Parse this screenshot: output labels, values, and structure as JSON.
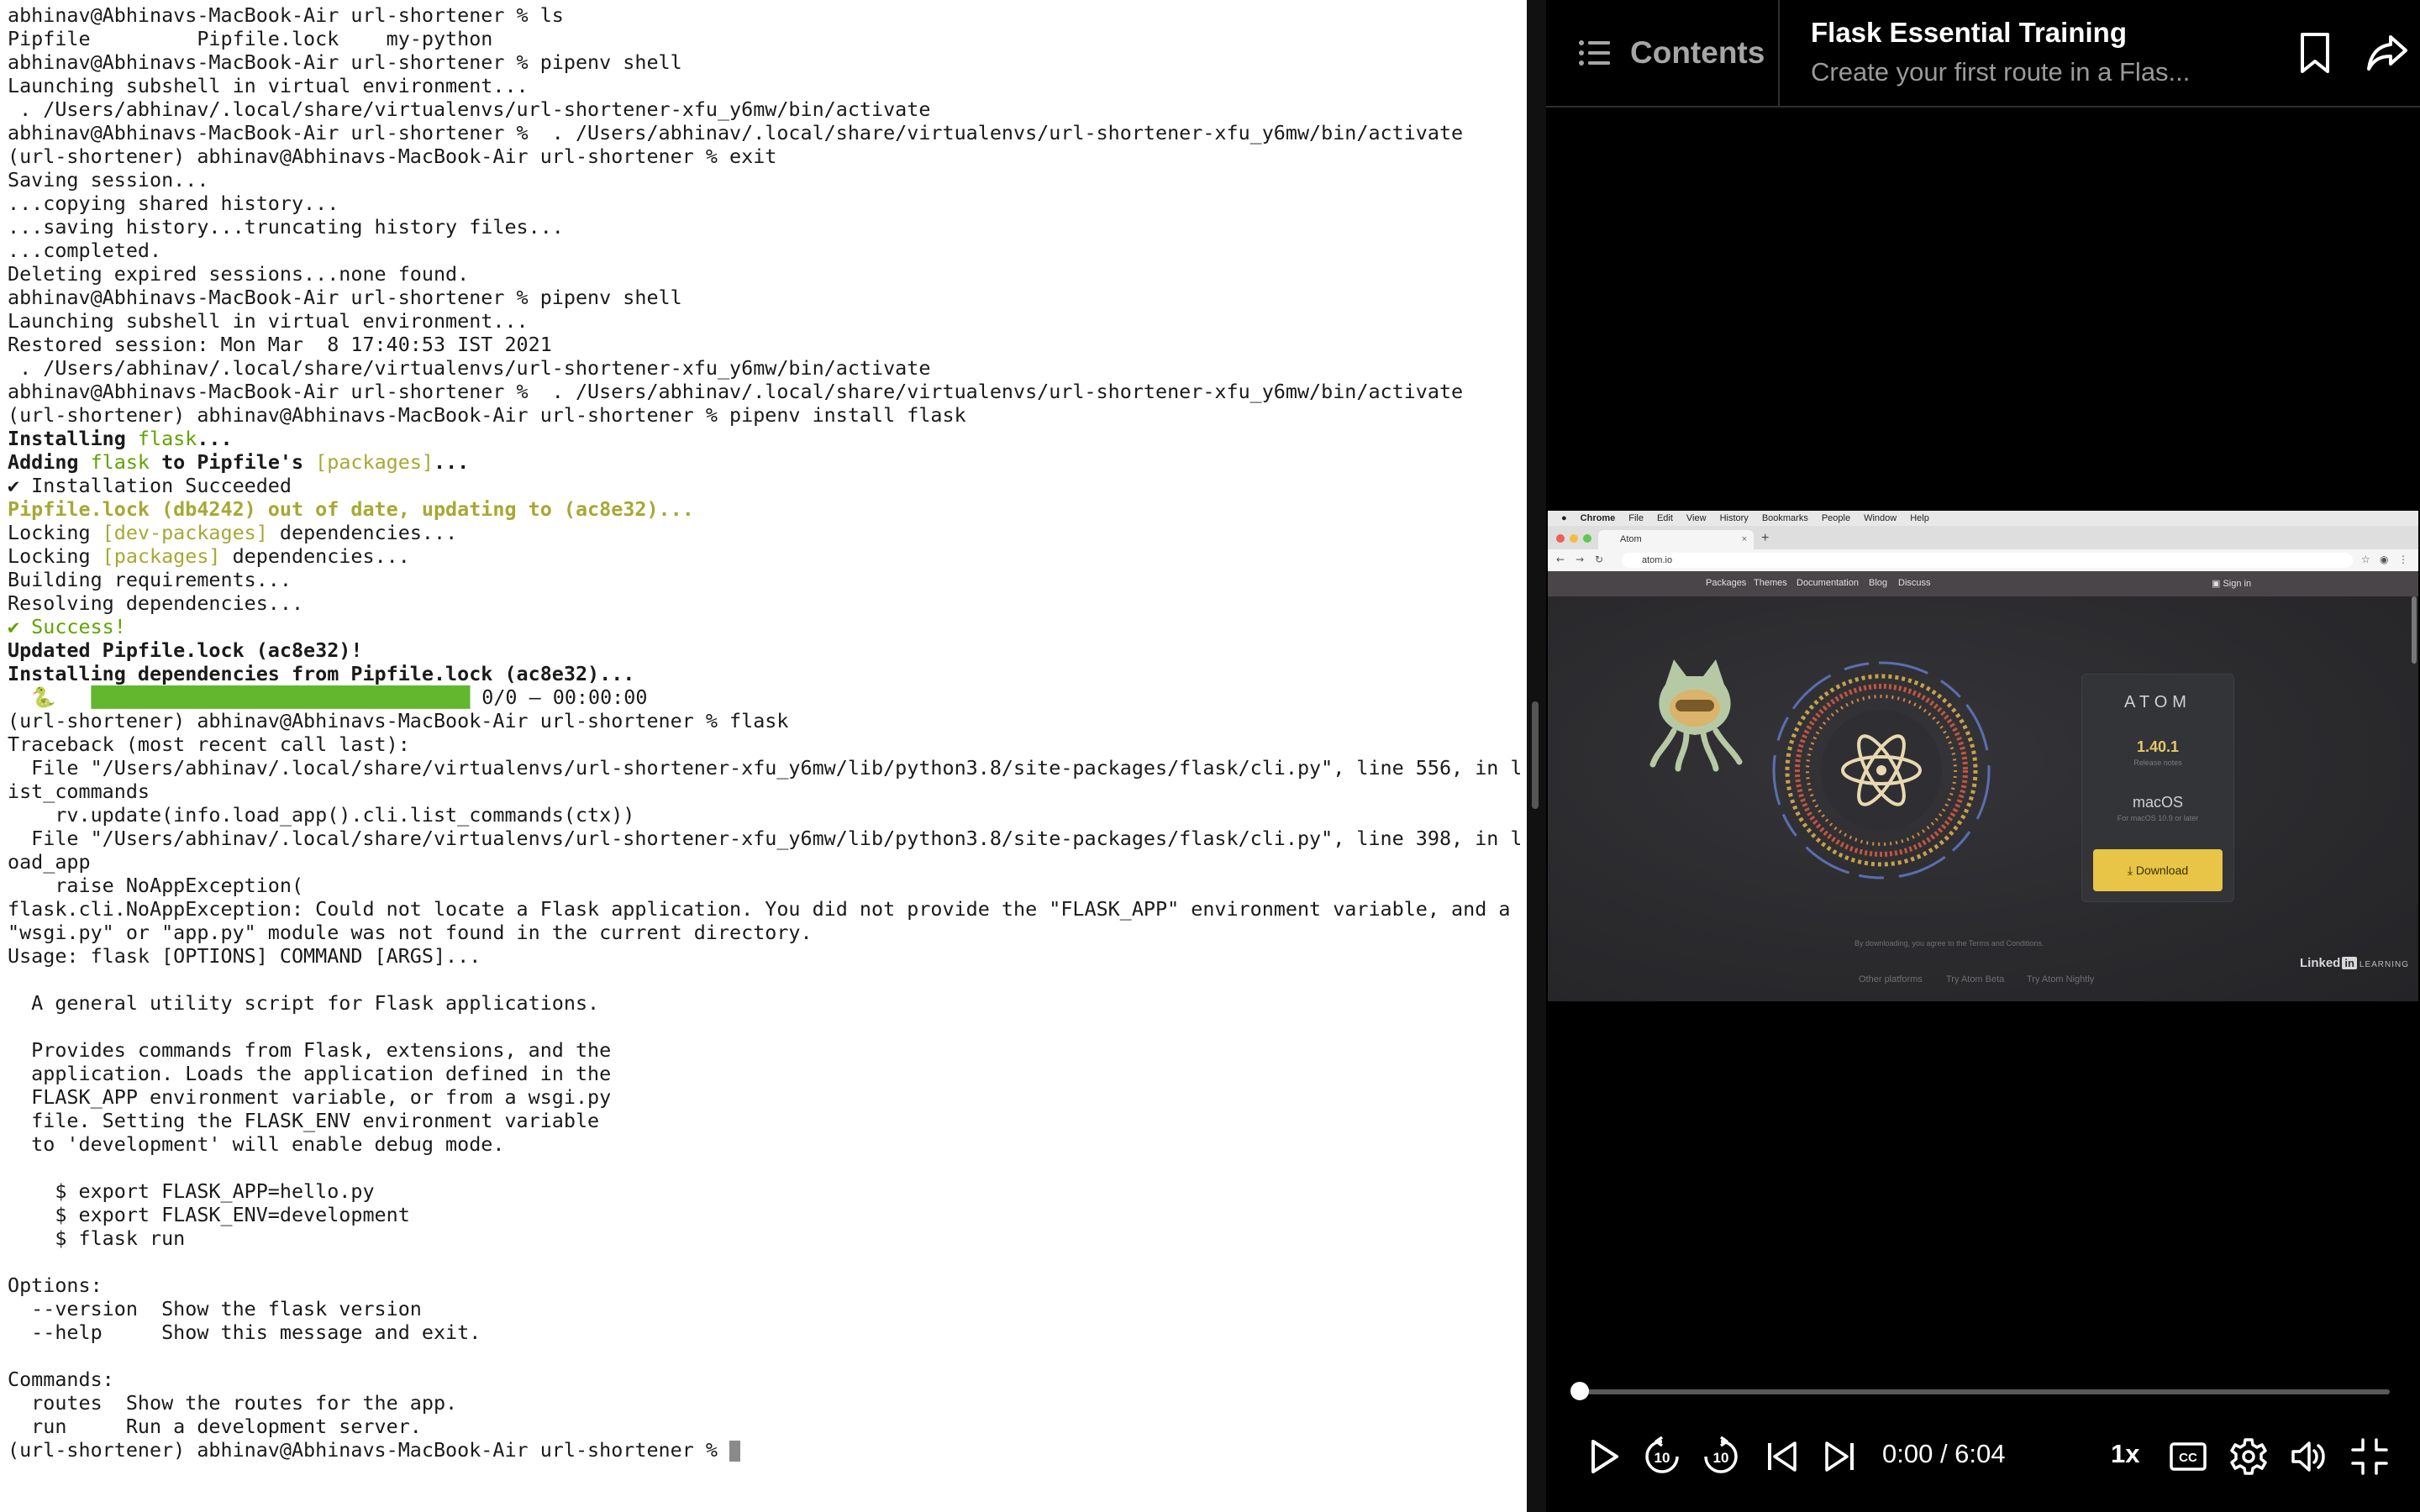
{
  "terminal": {
    "lines": [
      [
        {
          "t": "abhinav@Abhinavs-MacBook-Air url-shortener % ls"
        }
      ],
      [
        {
          "t": "Pipfile         Pipfile.lock    my-python"
        }
      ],
      [
        {
          "t": "abhinav@Abhinavs-MacBook-Air url-shortener % pipenv shell"
        }
      ],
      [
        {
          "t": "Launching subshell in virtual environment..."
        }
      ],
      [
        {
          "t": " . /Users/abhinav/.local/share/virtualenvs/url-shortener-xfu_y6mw/bin/activate"
        }
      ],
      [
        {
          "t": "abhinav@Abhinavs-MacBook-Air url-shortener %  . /Users/abhinav/.local/share/virtualenvs/url-shortener-xfu_y6mw/bin/activate"
        }
      ],
      [
        {
          "t": "(url-shortener) abhinav@Abhinavs-MacBook-Air url-shortener % exit"
        }
      ],
      [
        {
          "t": "Saving session..."
        }
      ],
      [
        {
          "t": "...copying shared history..."
        }
      ],
      [
        {
          "t": "...saving history...truncating history files..."
        }
      ],
      [
        {
          "t": "...completed."
        }
      ],
      [
        {
          "t": "Deleting expired sessions...none found."
        }
      ],
      [
        {
          "t": "abhinav@Abhinavs-MacBook-Air url-shortener % pipenv shell"
        }
      ],
      [
        {
          "t": "Launching subshell in virtual environment..."
        }
      ],
      [
        {
          "t": "Restored session: Mon Mar  8 17:40:53 IST 2021"
        }
      ],
      [
        {
          "t": " . /Users/abhinav/.local/share/virtualenvs/url-shortener-xfu_y6mw/bin/activate"
        }
      ],
      [
        {
          "t": "abhinav@Abhinavs-MacBook-Air url-shortener %  . /Users/abhinav/.local/share/virtualenvs/url-shortener-xfu_y6mw/bin/activate"
        }
      ],
      [
        {
          "t": "(url-shortener) abhinav@Abhinavs-MacBook-Air url-shortener % pipenv install flask"
        }
      ],
      [
        {
          "t": "Installing ",
          "c": "bold"
        },
        {
          "t": "flask",
          "c": "green"
        },
        {
          "t": "...",
          "c": "bold"
        }
      ],
      [
        {
          "t": "Adding ",
          "c": "bold"
        },
        {
          "t": "flask",
          "c": "green"
        },
        {
          "t": " to Pipfile's ",
          "c": "bold"
        },
        {
          "t": "[packages]",
          "c": "yel"
        },
        {
          "t": "...",
          "c": "bold"
        }
      ],
      [
        {
          "t": "✔ Installation Succeeded"
        }
      ],
      [
        {
          "t": "Pipfile.lock (db4242) out of date, updating to (ac8e32)...",
          "c": "ygb"
        }
      ],
      [
        {
          "t": "Locking "
        },
        {
          "t": "[dev-packages]",
          "c": "yel"
        },
        {
          "t": " dependencies..."
        }
      ],
      [
        {
          "t": "Locking "
        },
        {
          "t": "[packages]",
          "c": "yel"
        },
        {
          "t": " dependencies..."
        }
      ],
      [
        {
          "t": "Building requirements..."
        }
      ],
      [
        {
          "t": "Resolving dependencies..."
        }
      ],
      [
        {
          "t": "✔ Success!",
          "c": "green"
        }
      ],
      [
        {
          "t": "Updated Pipfile.lock (ac8e32)!",
          "c": "bold"
        }
      ],
      [
        {
          "t": "Installing dependencies from Pipfile.lock (ac8e32)...",
          "c": "bold"
        }
      ],
      [
        {
          "t": "  🐍   "
        },
        {
          "t": "████████████████████████████████",
          "c": "bar"
        },
        {
          "t": " 0/0 — 00:00:00"
        }
      ],
      [
        {
          "t": "(url-shortener) abhinav@Abhinavs-MacBook-Air url-shortener % flask"
        }
      ],
      [
        {
          "t": "Traceback (most recent call last):"
        }
      ],
      [
        {
          "t": "  File \"/Users/abhinav/.local/share/virtualenvs/url-shortener-xfu_y6mw/lib/python3.8/site-packages/flask/cli.py\", line 556, in l"
        }
      ],
      [
        {
          "t": "ist_commands"
        }
      ],
      [
        {
          "t": "    rv.update(info.load_app().cli.list_commands(ctx))"
        }
      ],
      [
        {
          "t": "  File \"/Users/abhinav/.local/share/virtualenvs/url-shortener-xfu_y6mw/lib/python3.8/site-packages/flask/cli.py\", line 398, in l"
        }
      ],
      [
        {
          "t": "oad_app"
        }
      ],
      [
        {
          "t": "    raise NoAppException("
        }
      ],
      [
        {
          "t": "flask.cli.NoAppException: Could not locate a Flask application. You did not provide the \"FLASK_APP\" environment variable, and a"
        }
      ],
      [
        {
          "t": "\"wsgi.py\" or \"app.py\" module was not found in the current directory."
        }
      ],
      [
        {
          "t": "Usage: flask [OPTIONS] COMMAND [ARGS]..."
        }
      ],
      [
        {
          "t": ""
        }
      ],
      [
        {
          "t": "  A general utility script for Flask applications."
        }
      ],
      [
        {
          "t": ""
        }
      ],
      [
        {
          "t": "  Provides commands from Flask, extensions, and the"
        }
      ],
      [
        {
          "t": "  application. Loads the application defined in the"
        }
      ],
      [
        {
          "t": "  FLASK_APP environment variable, or from a wsgi.py"
        }
      ],
      [
        {
          "t": "  file. Setting the FLASK_ENV environment variable"
        }
      ],
      [
        {
          "t": "  to 'development' will enable debug mode."
        }
      ],
      [
        {
          "t": ""
        }
      ],
      [
        {
          "t": "    $ export FLASK_APP=hello.py"
        }
      ],
      [
        {
          "t": "    $ export FLASK_ENV=development"
        }
      ],
      [
        {
          "t": "    $ flask run"
        }
      ],
      [
        {
          "t": ""
        }
      ],
      [
        {
          "t": "Options:"
        }
      ],
      [
        {
          "t": "  --version  Show the flask version"
        }
      ],
      [
        {
          "t": "  --help     Show this message and exit."
        }
      ],
      [
        {
          "t": ""
        }
      ],
      [
        {
          "t": "Commands:"
        }
      ],
      [
        {
          "t": "  routes  Show the routes for the app."
        }
      ],
      [
        {
          "t": "  run     Run a development server."
        }
      ],
      [
        {
          "t": "(url-shortener) abhinav@Abhinavs-MacBook-Air url-shortener % "
        },
        {
          "cursor": true
        }
      ]
    ]
  },
  "player": {
    "contents_label": "Contents",
    "course_title": "Flask Essential Training",
    "video_subtitle": "Create your first route in a Flas...",
    "time": "0:00 / 6:04",
    "speed": "1x",
    "progress_fraction": 0.0,
    "icons": {
      "contents": "list-icon",
      "bookmark": "bookmark-icon",
      "share": "share-icon",
      "play": "play-icon",
      "rewind": "rewind-10-icon",
      "forward": "forward-10-icon",
      "previous": "skip-previous-icon",
      "next": "skip-next-icon",
      "captions": "closed-captions-icon",
      "settings": "gear-icon",
      "volume": "volume-icon",
      "exit_fullscreen": "exit-fullscreen-icon"
    }
  },
  "video_frame": {
    "mac_menu": [
      "Chrome",
      "File",
      "Edit",
      "View",
      "History",
      "Bookmarks",
      "People",
      "Window",
      "Help"
    ],
    "tab_title": "Atom",
    "address": "atom.io",
    "site_nav": [
      "Packages",
      "Themes",
      "Documentation",
      "Blog",
      "Discuss"
    ],
    "sign_in": "Sign in",
    "card": {
      "brand": "ATOM",
      "version": "1.40.1",
      "release_notes": "Release notes",
      "os": "macOS",
      "os_note": "For macOS 10.9 or later",
      "download": "Download"
    },
    "footer_note": "By downloading, you agree to the Terms and Conditions.",
    "footer_links": [
      "Other platforms",
      "Try Atom Beta",
      "Try Atom Nightly"
    ],
    "watermark": {
      "brand": "Linked",
      "in": "in",
      "learning": "LEARNING"
    }
  },
  "colors": {
    "terminal_bg": "#ffffff",
    "terminal_text": "#1a1a1a",
    "green": "#5ea400",
    "yellow": "#a7a833",
    "player_bg": "#000000",
    "download_yellow": "#e8c547"
  }
}
